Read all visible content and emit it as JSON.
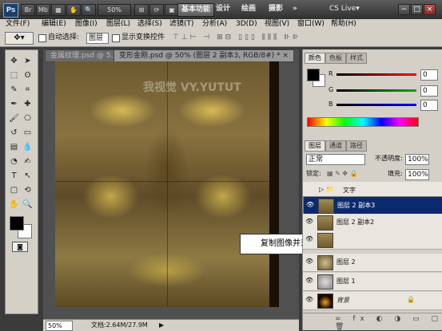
{
  "titlebar": {
    "logo": "Ps",
    "zoom": "50%",
    "workspaces": [
      "基本功能",
      "设计",
      "绘画",
      "摄影"
    ],
    "more": "»",
    "cslive": "CS Live▾",
    "controls": [
      "−",
      "□",
      "×"
    ]
  },
  "menubar": {
    "items": [
      "文件(F)",
      "编辑(E)",
      "图像(I)",
      "图层(L)",
      "选择(S)",
      "滤镜(T)",
      "分析(A)",
      "3D(D)",
      "视图(V)",
      "窗口(W)",
      "帮助(H)"
    ]
  },
  "options": {
    "auto_select_label": "自动选择:",
    "auto_select_value": "图层",
    "show_transform_label": "显示变换控件"
  },
  "document": {
    "tabs": [
      "金属纹理.psd @ 5...",
      "变形金刚.psd @ 50% (图层 2 副本3, RGB/8#) *"
    ],
    "zoom": "50%",
    "doc_size": "文档:2.64M/27.9M",
    "callout": "复制图像并对其进行翻转和排列",
    "watermark": "我视觉 VY.YUTUT"
  },
  "color_panel": {
    "tabs": [
      "颜色",
      "色板",
      "样式"
    ],
    "channels": [
      {
        "label": "R",
        "value": "0"
      },
      {
        "label": "G",
        "value": "0"
      },
      {
        "label": "B",
        "value": "0"
      }
    ]
  },
  "layers_panel": {
    "tabs": [
      "图层",
      "通道",
      "路径"
    ],
    "blend_mode": "正常",
    "opacity_label": "不透明度:",
    "opacity_value": "100%",
    "lock_label": "锁定:",
    "fill_label": "填充:",
    "fill_value": "100%",
    "layers": [
      {
        "name": "文字",
        "type": "group",
        "selected": false
      },
      {
        "name": "图层 2 副本3",
        "type": "layer",
        "selected": true
      },
      {
        "name": "图层 2 副本2",
        "type": "layer",
        "selected": false
      },
      {
        "name": "",
        "type": "layer",
        "selected": false
      },
      {
        "name": "图层 2",
        "type": "layer",
        "selected": false
      },
      {
        "name": "图层 1",
        "type": "layer",
        "selected": false
      },
      {
        "name": "背景",
        "type": "background",
        "selected": false
      }
    ]
  },
  "colors": {
    "foreground": "#000000",
    "background": "#ffffff",
    "selection": "#0b2a6e"
  }
}
